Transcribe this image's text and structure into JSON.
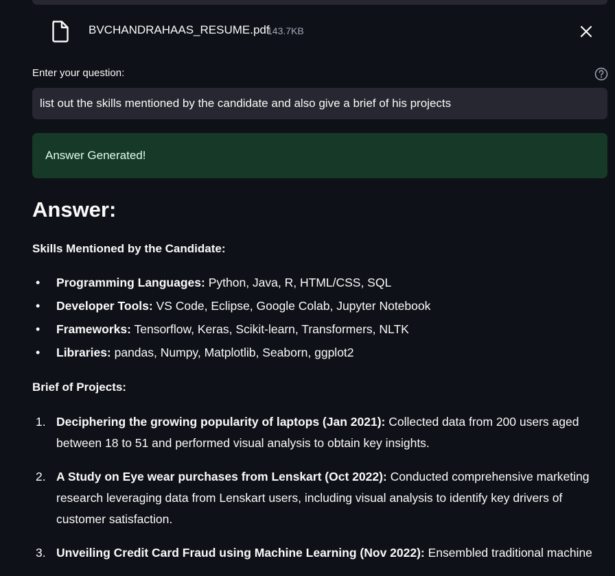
{
  "uploaded_file": {
    "name": "BVCHANDRAHAAS_RESUME.pdf",
    "size": "143.7KB"
  },
  "question": {
    "label": "Enter your question:",
    "value": "list out the skills mentioned by the candidate and also give a brief of his projects"
  },
  "status": {
    "message": "Answer Generated!"
  },
  "answer": {
    "heading": "Answer:",
    "skills_heading": "Skills Mentioned by the Candidate:",
    "skills": [
      {
        "label": "Programming Languages:",
        "text": " Python, Java, R, HTML/CSS, SQL"
      },
      {
        "label": "Developer Tools:",
        "text": " VS Code, Eclipse, Google Colab, Jupyter Notebook"
      },
      {
        "label": "Frameworks:",
        "text": " Tensorflow, Keras, Scikit-learn, Transformers, NLTK"
      },
      {
        "label": "Libraries:",
        "text": " pandas, Numpy, Matplotlib, Seaborn, ggplot2"
      }
    ],
    "projects_heading": "Brief of Projects:",
    "projects": [
      {
        "num": "1.",
        "title": "Deciphering the growing popularity of laptops (Jan 2021):",
        "text": " Collected data from 200 users aged between 18 to 51 and performed visual analysis to obtain key insights."
      },
      {
        "num": "2.",
        "title": "A Study on Eye wear purchases from Lenskart (Oct 2022):",
        "text": " Conducted comprehensive marketing research leveraging data from Lenskart users, including visual analysis to identify key drivers of customer satisfaction."
      },
      {
        "num": "3.",
        "title": "Unveiling Credit Card Fraud using Machine Learning (Nov 2022):",
        "text": " Ensembled traditional machine"
      }
    ]
  },
  "colors": {
    "background": "#0e1117",
    "input_bg": "#262730",
    "success_bg": "#173928",
    "success_text": "#dffde9"
  }
}
